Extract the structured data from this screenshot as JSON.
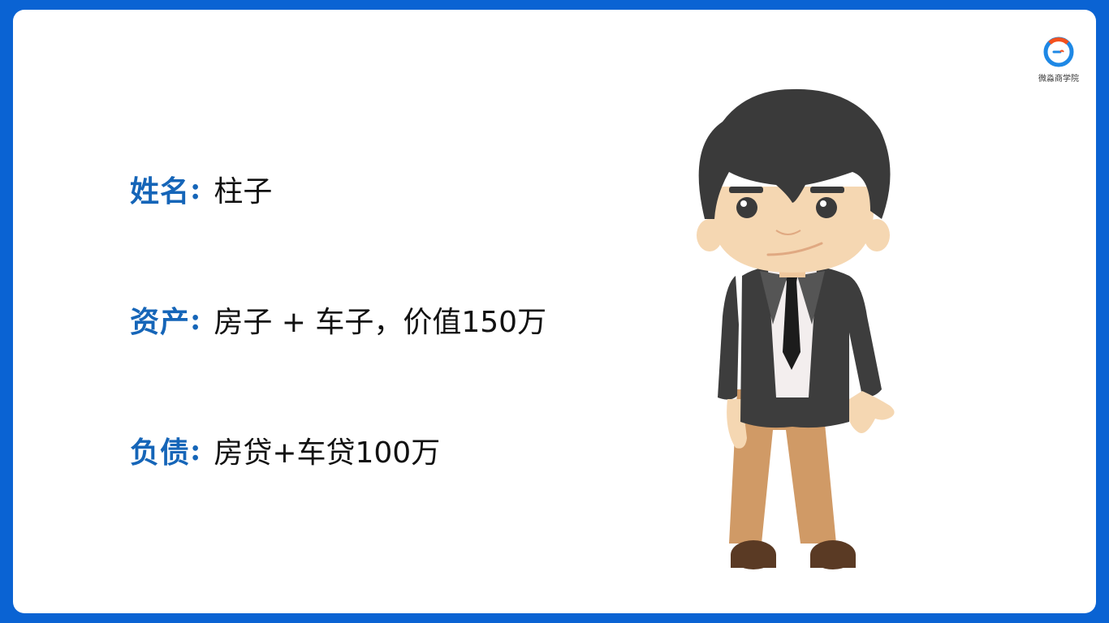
{
  "logo": {
    "text": "微淼商学院",
    "icon": "brand-ring-icon",
    "colors": {
      "ring": "#1e88e5",
      "accent": "#f4511e"
    }
  },
  "profile": {
    "name": {
      "label": "姓名",
      "colon": ":",
      "value": "柱子"
    },
    "assets": {
      "label": "资产",
      "colon": ":",
      "value": "房子 + 车子，价值150万"
    },
    "debt": {
      "label": "负债",
      "colon": ":",
      "value": "房贷+车贷100万"
    }
  },
  "illustration": {
    "subject": "businessman-cartoon"
  },
  "colors": {
    "background": "#0a63d3",
    "card": "#ffffff",
    "label": "#1565b8",
    "text": "#111111"
  }
}
